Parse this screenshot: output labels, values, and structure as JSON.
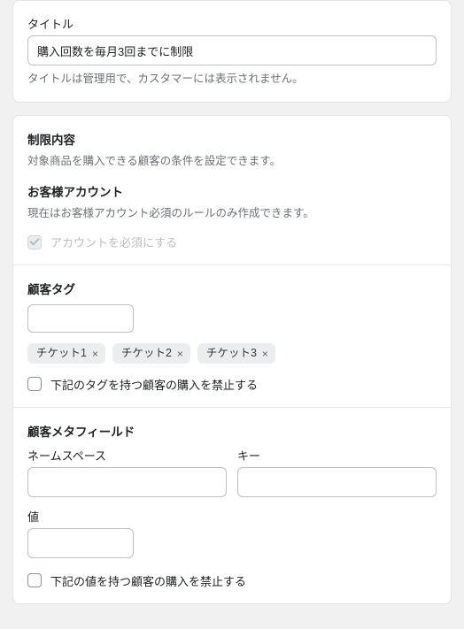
{
  "title_section": {
    "label": "タイトル",
    "value": "購入回数を毎月3回までに制限",
    "help": "タイトルは管理用で、カスタマーには表示されません。"
  },
  "restriction": {
    "heading": "制限内容",
    "desc": "対象商品を購入できる顧客の条件を設定できます。",
    "account_heading": "お客様アカウント",
    "account_desc": "現在はお客様アカウント必須のルールのみ作成できます。",
    "account_checkbox_label": "アカウントを必須にする",
    "tag_heading": "顧客タグ",
    "tags": [
      "チケット1",
      "チケット2",
      "チケット3"
    ],
    "tag_ban_label": "下記のタグを持つ顧客の購入を禁止する",
    "metafield_heading": "顧客メタフィールド",
    "namespace_label": "ネームスペース",
    "key_label": "キー",
    "value_label": "値",
    "value_ban_label": "下記の値を持つ顧客の購入を禁止する"
  }
}
